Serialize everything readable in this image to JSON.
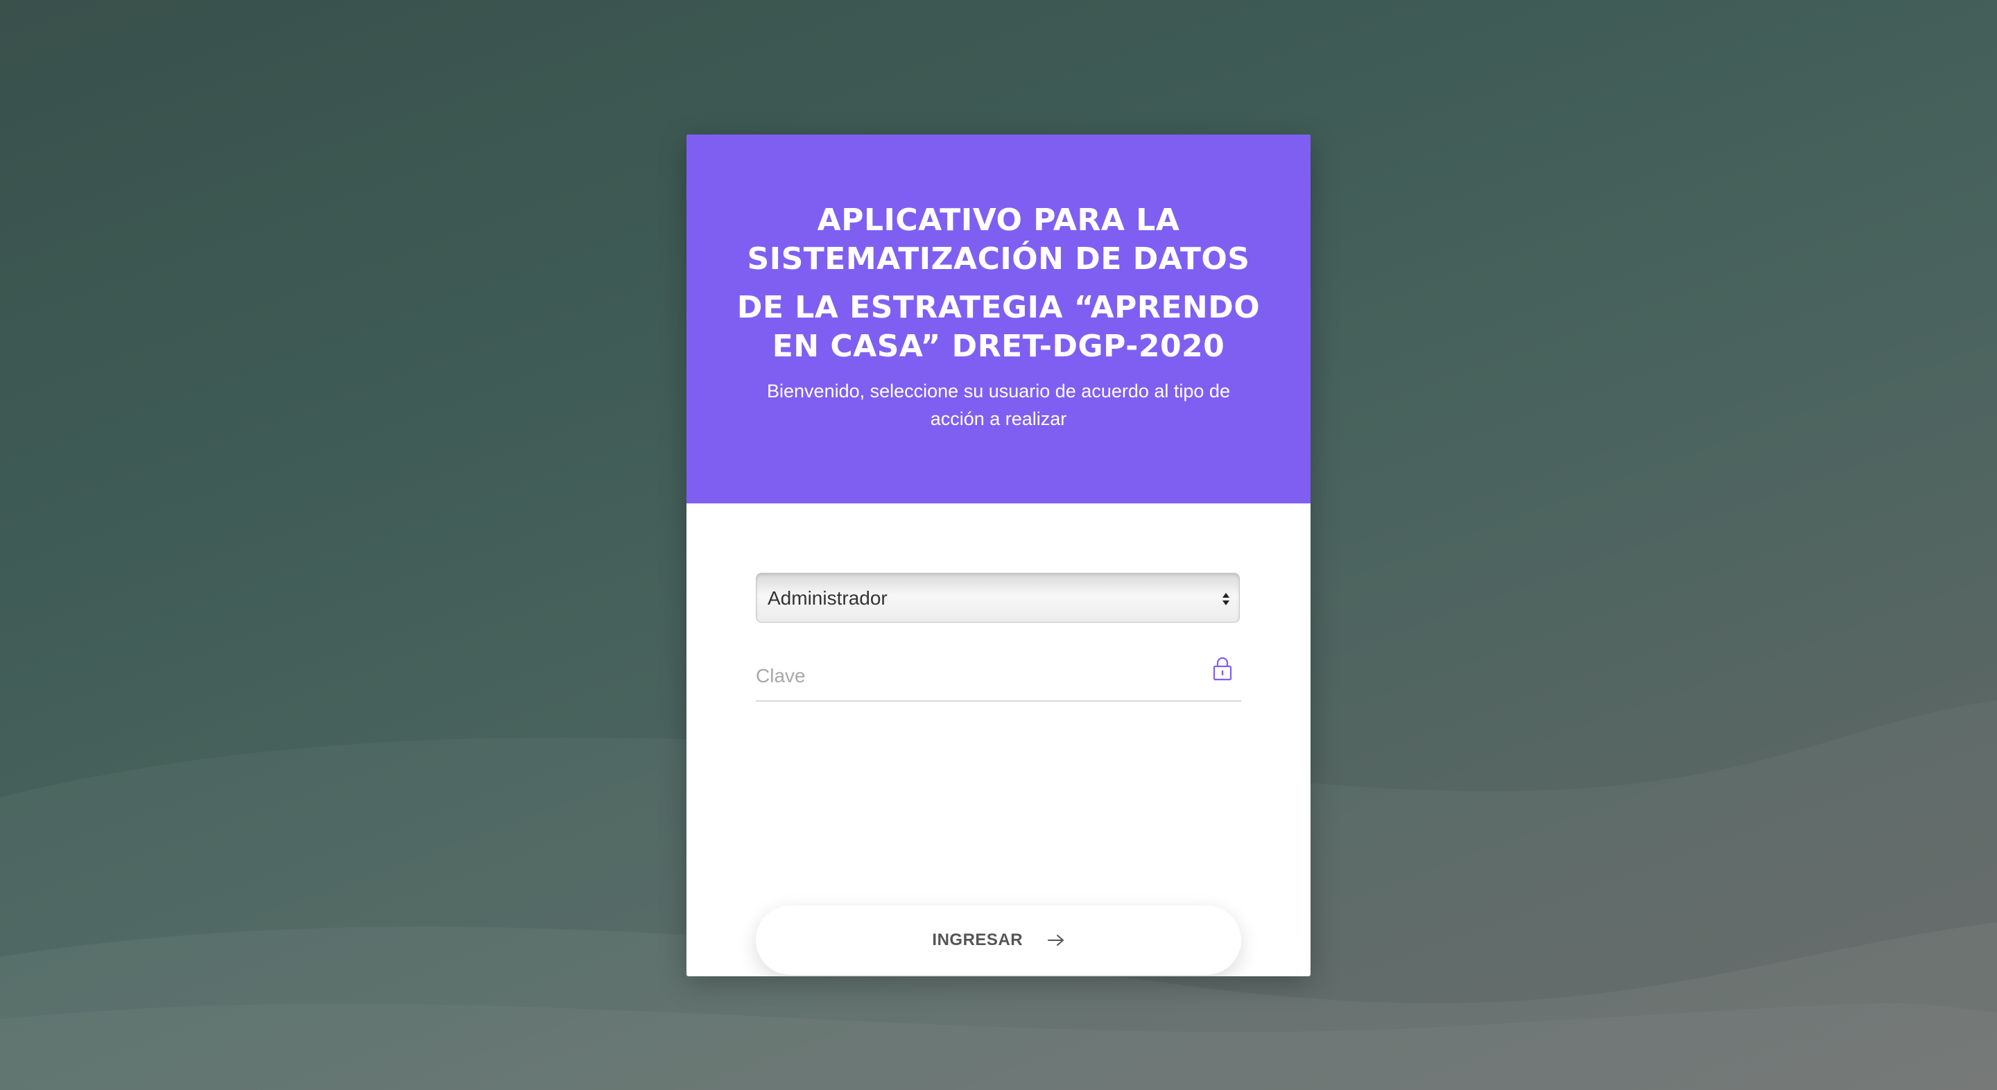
{
  "background": {
    "colors": [
      "#39504b",
      "#646866"
    ]
  },
  "header": {
    "title_line1": "APLICATIVO PARA LA SISTEMATIZACIÓN DE DATOS",
    "title_line2": "DE LA ESTRATEGIA “APRENDO EN CASA” DRET-DGP-2020",
    "subtitle": "Bienvenido, seleccione su usuario de acuerdo al tipo de acción a realizar",
    "color": "#7f5ff2"
  },
  "form": {
    "user_select": {
      "value": "Administrador",
      "icon": "select-arrows-icon"
    },
    "password": {
      "placeholder": "Clave",
      "value": "",
      "icon": "lock-icon",
      "icon_color": "#7f5ff2"
    },
    "submit": {
      "label": "INGRESAR",
      "icon": "arrow-right-icon"
    }
  }
}
